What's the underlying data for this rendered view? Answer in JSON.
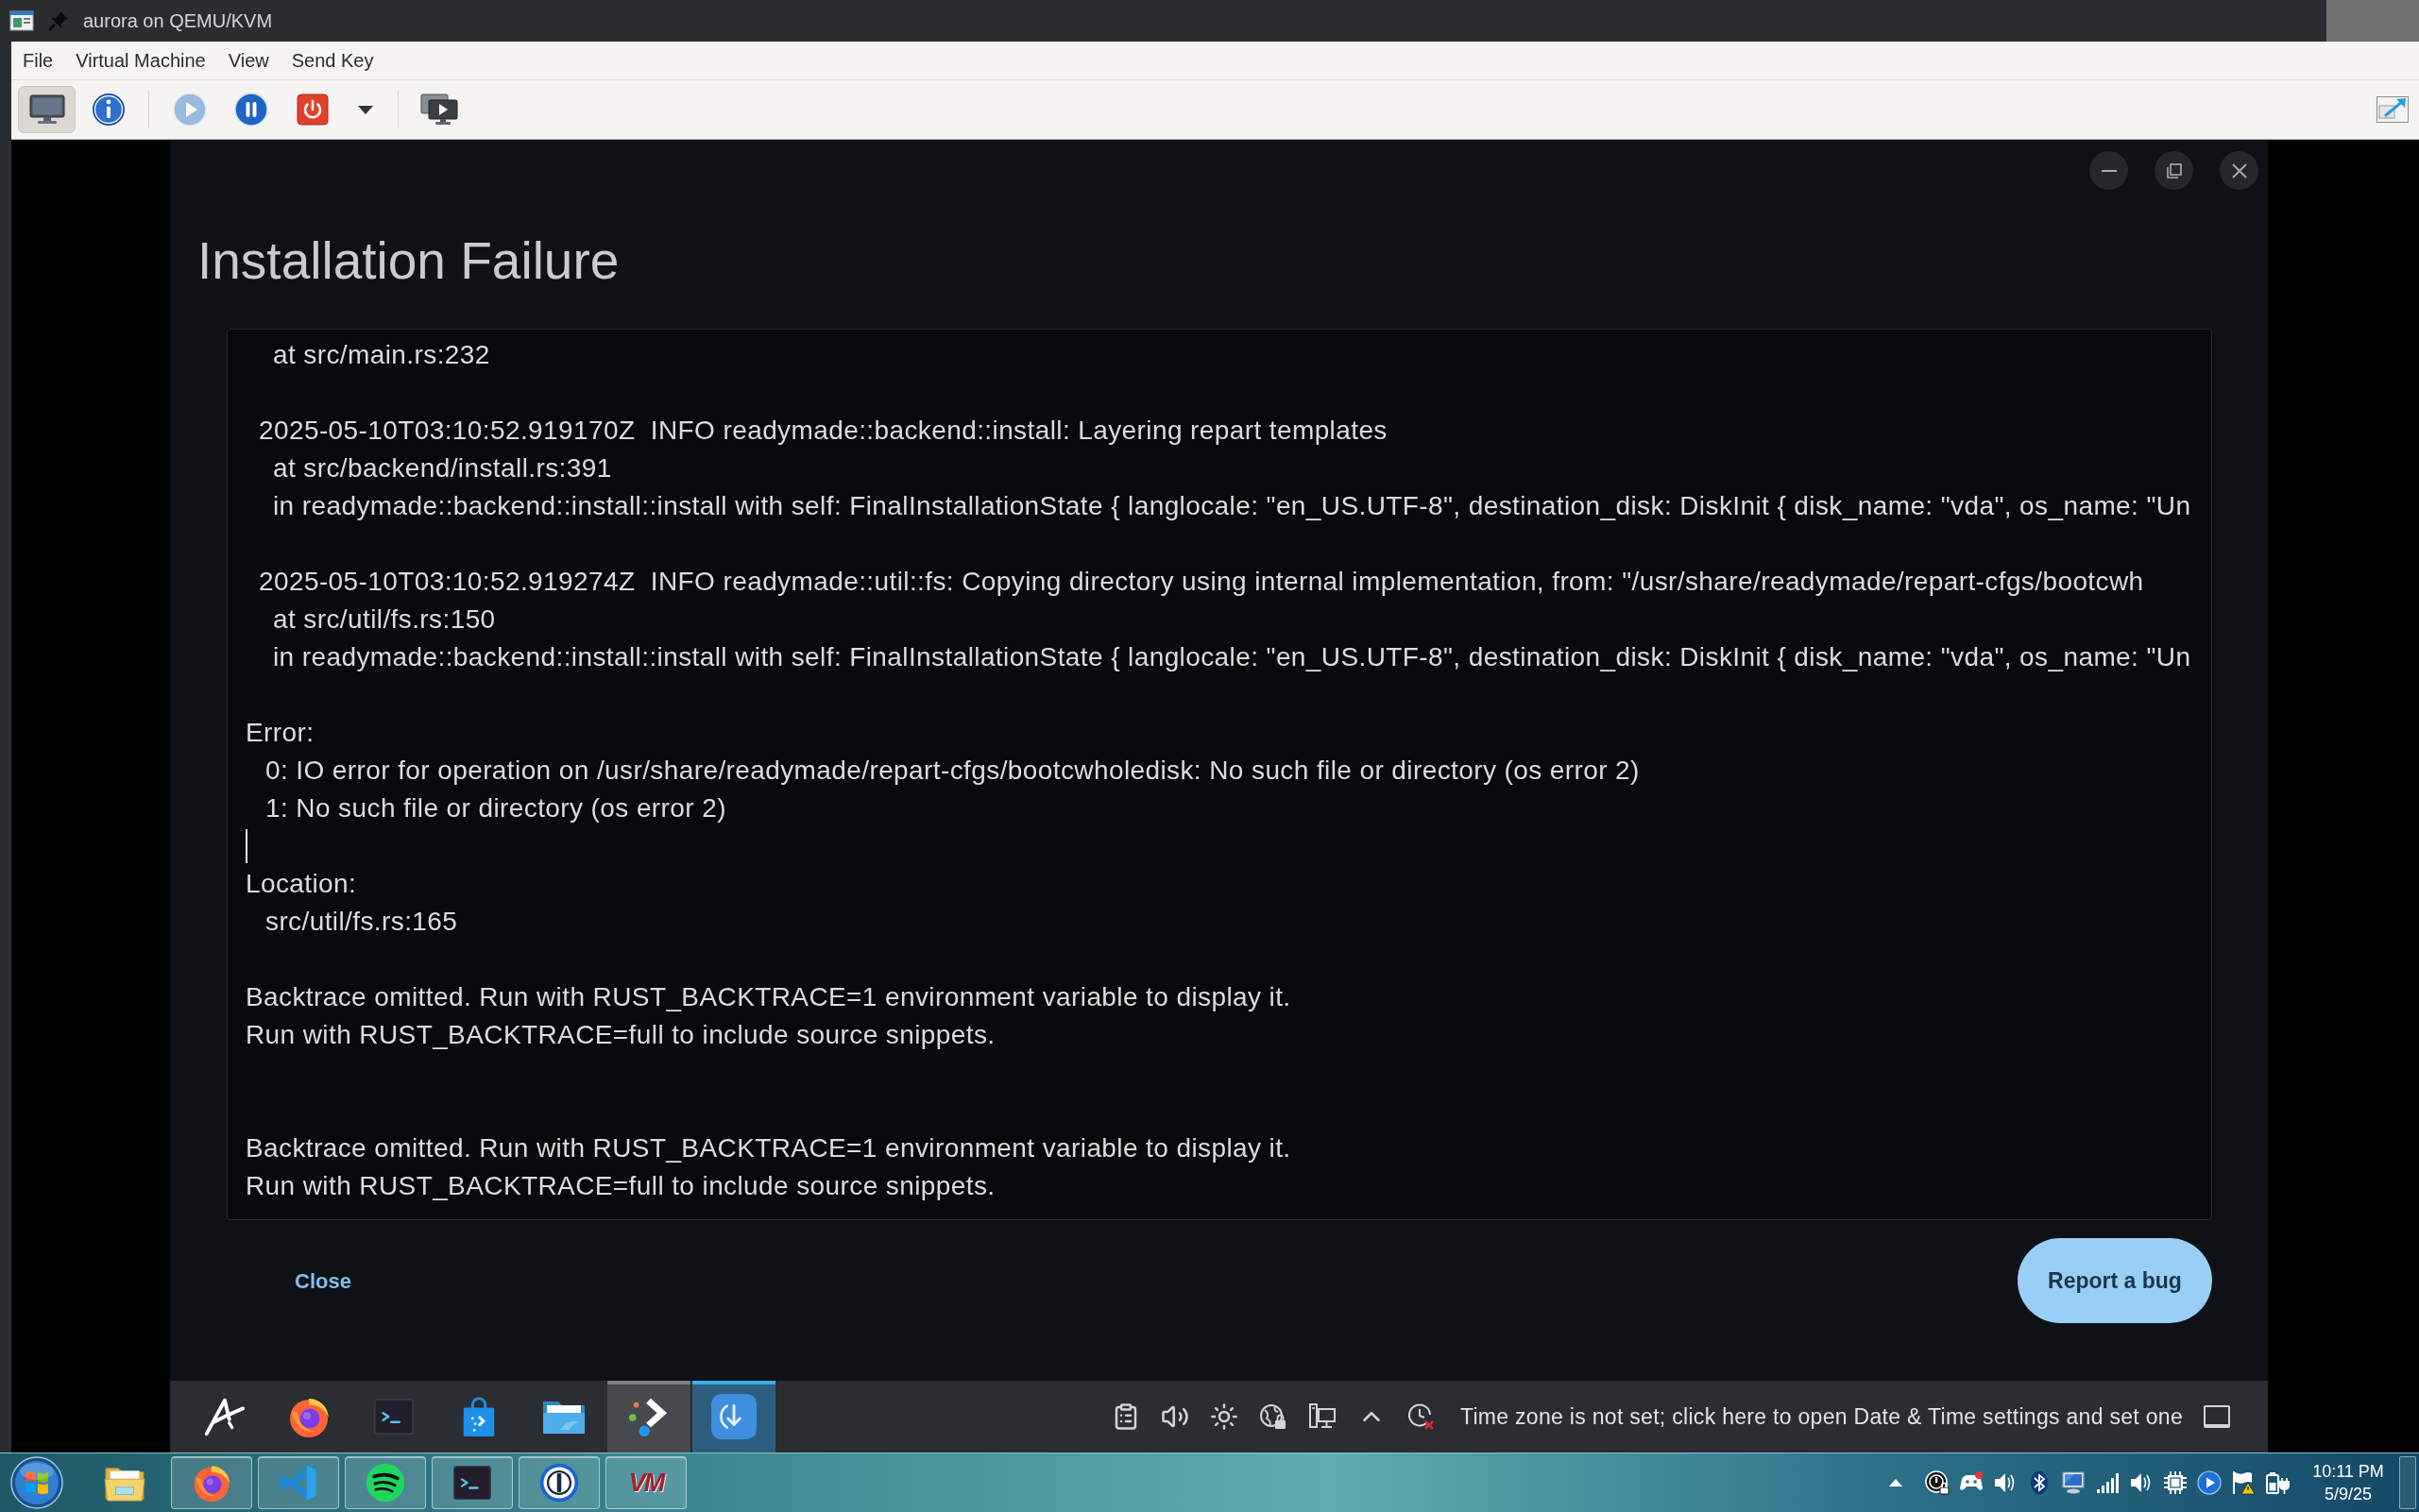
{
  "window": {
    "title": "aurora on QEMU/KVM"
  },
  "menu": [
    {
      "label": "File"
    },
    {
      "label": "Virtual Machine"
    },
    {
      "label": "View"
    },
    {
      "label": "Send Key"
    }
  ],
  "toolbar": {
    "view_buttons": [
      {
        "kind": "console",
        "selected": true
      },
      {
        "kind": "details",
        "selected": false
      }
    ],
    "power_buttons": [
      {
        "kind": "run",
        "disabled": true
      },
      {
        "kind": "pause",
        "disabled": false
      },
      {
        "kind": "shutdown",
        "disabled": false
      },
      {
        "kind": "shutdown-menu",
        "disabled": false
      }
    ]
  },
  "guest": {
    "dialog": {
      "title": "Installation Failure",
      "log": [
        {
          "kind": "detail",
          "text": "at src/main.rs:232"
        },
        {
          "kind": "blank"
        },
        {
          "kind": "entry",
          "text": "2025-05-10T03:10:52.919170Z  INFO readymade::backend::install: Layering repart templates"
        },
        {
          "kind": "detail",
          "text": "at src/backend/install.rs:391"
        },
        {
          "kind": "detail",
          "text": "in readymade::backend::install::install with self: FinalInstallationState { langlocale: \"en_US.UTF-8\", destination_disk: DiskInit { disk_name: \"vda\", os_name: \"Un"
        },
        {
          "kind": "blank"
        },
        {
          "kind": "entry",
          "text": "2025-05-10T03:10:52.919274Z  INFO readymade::util::fs: Copying directory using internal implementation, from: \"/usr/share/readymade/repart-cfgs/bootcwh"
        },
        {
          "kind": "detail",
          "text": "at src/util/fs.rs:150"
        },
        {
          "kind": "detail",
          "text": "in readymade::backend::install::install with self: FinalInstallationState { langlocale: \"en_US.UTF-8\", destination_disk: DiskInit { disk_name: \"vda\", os_name: \"Un"
        },
        {
          "kind": "blank"
        },
        {
          "kind": "plain",
          "text": "Error:"
        },
        {
          "kind": "item",
          "text": "0: IO error for operation on /usr/share/readymade/repart-cfgs/bootcwholedisk: No such file or directory (os error 2)"
        },
        {
          "kind": "item",
          "text": "1: No such file or directory (os error 2)"
        },
        {
          "kind": "cursor"
        },
        {
          "kind": "plain",
          "text": "Location:"
        },
        {
          "kind": "item",
          "text": "src/util/fs.rs:165"
        },
        {
          "kind": "blank"
        },
        {
          "kind": "plain",
          "text": "Backtrace omitted. Run with RUST_BACKTRACE=1 environment variable to display it."
        },
        {
          "kind": "plain",
          "text": "Run with RUST_BACKTRACE=full to include source snippets."
        },
        {
          "kind": "blank"
        },
        {
          "kind": "blank"
        },
        {
          "kind": "plain",
          "text": "Backtrace omitted. Run with RUST_BACKTRACE=1 environment variable to display it."
        },
        {
          "kind": "plain",
          "text": "Run with RUST_BACKTRACE=full to include source snippets."
        }
      ],
      "close_label": "Close",
      "report_label": "Report a bug"
    },
    "taskbar": {
      "apps": [
        {
          "kind": "logo",
          "open": false,
          "selected": false
        },
        {
          "kind": "browser",
          "open": false,
          "selected": false
        },
        {
          "kind": "terminal",
          "open": false,
          "selected": false
        },
        {
          "kind": "store",
          "open": false,
          "selected": false
        },
        {
          "kind": "files",
          "open": false,
          "selected": false
        },
        {
          "kind": "connect",
          "open": true,
          "selected": false
        },
        {
          "kind": "installer",
          "open": true,
          "selected": true
        }
      ],
      "notice": "Time zone is not set; click here to open Date & Time settings and set one"
    }
  },
  "host_taskbar": {
    "apps": [
      {
        "kind": "explorer",
        "running": false
      },
      {
        "kind": "browser",
        "running": true
      },
      {
        "kind": "editor",
        "running": true
      },
      {
        "kind": "music",
        "running": true
      },
      {
        "kind": "terminal",
        "running": true
      },
      {
        "kind": "password",
        "running": true
      },
      {
        "kind": "vm",
        "running": true,
        "label": "VM"
      }
    ],
    "clock": {
      "time": "10:11 PM",
      "date": "5/9/25"
    }
  }
}
